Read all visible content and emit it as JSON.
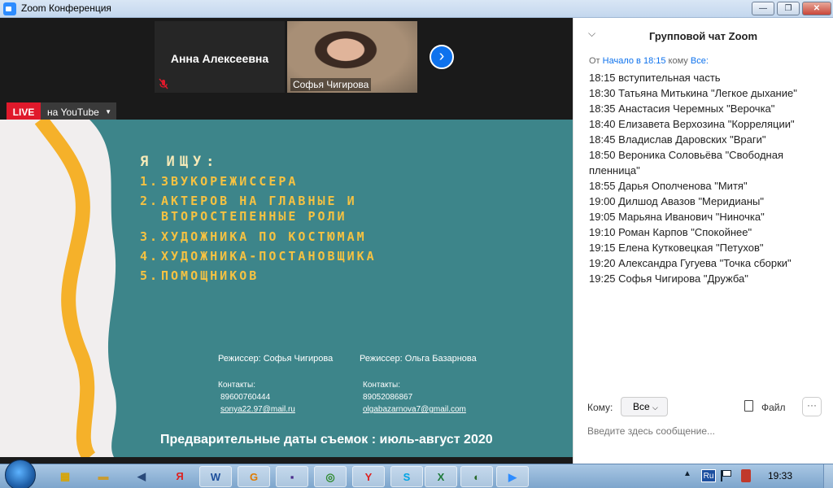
{
  "window": {
    "title": "Zoom Конференция",
    "minimize": "—",
    "maximize": "❐",
    "close": "✕"
  },
  "participants": [
    {
      "name": "Анна Алексеевна",
      "muted": true
    },
    {
      "name": "Софья Чигирова"
    }
  ],
  "live": {
    "badge": "LIVE",
    "destination": "на YouTube",
    "caret": "▼"
  },
  "slide": {
    "title": "Я ИЩУ:",
    "items": [
      {
        "num": "1.",
        "text": "ЗВУКОРЕЖИССЕРА"
      },
      {
        "num": "2.",
        "text": "АКТЕРОВ НА ГЛАВНЫЕ И"
      },
      {
        "num": "",
        "text": "ВТОРОСТЕПЕННЫЕ РОЛИ"
      },
      {
        "num": "3.",
        "text": "ХУДОЖНИКА ПО КОСТЮМАМ"
      },
      {
        "num": "4.",
        "text": "ХУДОЖНИКА-ПОСТАНОВЩИКА"
      },
      {
        "num": "5.",
        "text": "ПОМОЩНИКОВ"
      }
    ],
    "director1": "Режиссер: Софья Чигирова",
    "director2": "Режиссер: Ольга Базарнова",
    "contacts_label": "Контакты:",
    "phone1": "89600760444",
    "email1": "sonya22.97@mail.ru",
    "phone2": "89052086867",
    "email2": "olgabazarnova7@gmail.com",
    "dates": "Предварительные даты съемок : июль-август 2020",
    "colors": {
      "background": "#3d858a",
      "stripe": "#f5b12a",
      "items": "#f5c242"
    }
  },
  "chat": {
    "collapse_icon": "chevron-down-icon",
    "title": "Групповой чат Zoom",
    "meta_prefix": "От",
    "meta_link": "Начало в 18:15",
    "meta_mid": "кому",
    "meta_to": "Все:",
    "messages": [
      "18:15 вступительная часть",
      "18:30 Татьяна Митькина \"Легкое дыхание\"",
      "18:35 Анастасия Черемных \"Верочка\"",
      "18:40 Елизавета Верхозина \"Корреляции\"",
      "18:45 Владислав Даровских \"Враги\"",
      "18:50 Вероника Соловьёва \"Свободная пленница\"",
      "18:55 Дарья Ополченова \"Митя\"",
      "19:00 Дилшод Авазов \"Меридианы\"",
      "19:05 Марьяна Иванович \"Ниночка\"",
      "19:10 Роман Карпов \"Спокойнее\"",
      "19:15 Елена Кутковецкая \"Петухов\"",
      "19:20 Александра Гугуева \"Точка сборки\"",
      "19:25 Софья Чигирова \"Дружба\""
    ],
    "to_label": "Кому:",
    "to_value": "Все",
    "file_label": "Файл",
    "more": "···",
    "input_placeholder": "Введите здесь сообщение..."
  },
  "taskbar": {
    "apps": [
      {
        "icon": "windows-explorer-icon",
        "glyph": "▦",
        "color": "#d9a400"
      },
      {
        "icon": "folder-icon",
        "glyph": "▬",
        "color": "#c89b30"
      },
      {
        "icon": "volume-icon",
        "glyph": "◀",
        "color": "#2a4a7a"
      },
      {
        "icon": "yandex-icon",
        "glyph": "Я",
        "color": "#d22"
      },
      {
        "icon": "word-icon",
        "glyph": "W",
        "color": "#1d4f9c"
      },
      {
        "icon": "orange-app-icon",
        "glyph": "G",
        "color": "#e07b00"
      },
      {
        "icon": "save-app-icon",
        "glyph": "▪",
        "color": "#4a2a8a"
      },
      {
        "icon": "chrome-icon",
        "glyph": "◎",
        "color": "#2f8a2f"
      },
      {
        "icon": "yandex-browser-icon",
        "glyph": "Y",
        "color": "#d22"
      },
      {
        "icon": "skype-icon",
        "glyph": "S",
        "color": "#00a4e4"
      },
      {
        "icon": "excel-icon",
        "glyph": "X",
        "color": "#1e7a3a"
      },
      {
        "icon": "paint-icon",
        "glyph": "◐",
        "color": "#2a6a2a"
      },
      {
        "icon": "zoom-icon",
        "glyph": "▶",
        "color": "#2d8cff"
      }
    ],
    "tray_chevron": "▲",
    "lang": "Ru",
    "clock": "19:33"
  }
}
